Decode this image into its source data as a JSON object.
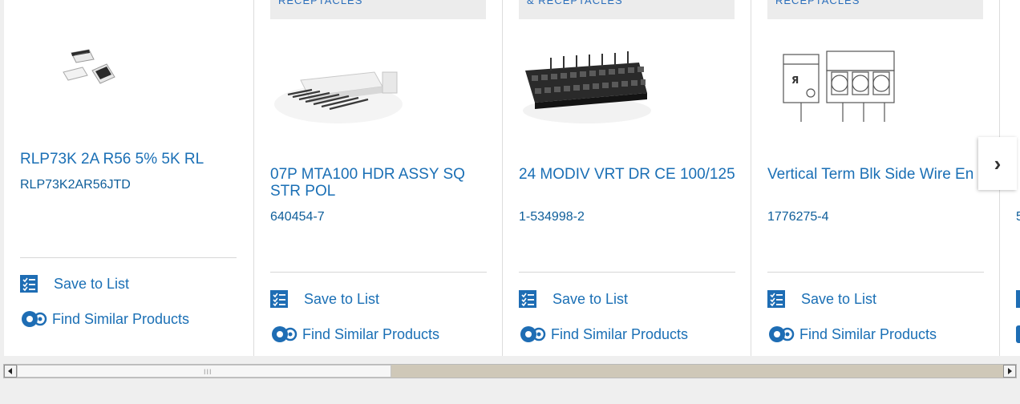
{
  "products": [
    {
      "category": "",
      "title": "RLP73K 2A R56 5% 5K RL",
      "part_number": "RLP73K2AR56JTD",
      "image": "smd-resistor-chips"
    },
    {
      "category": "RECEPTACLES",
      "title": "07P MTA100 HDR ASSY SQ STR POL",
      "part_number": "640454-7",
      "image": "mta-header-connector"
    },
    {
      "category": "& RECEPTACLES",
      "title": "24 MODIV VRT DR CE 100/125",
      "part_number": "1-534998-2",
      "image": "dual-row-receptacle"
    },
    {
      "category": "RECEPTACLES",
      "title": "Vertical Term Blk Side Wire En",
      "part_number": "1776275-4",
      "image": "terminal-block-drawing"
    },
    {
      "category": "",
      "title": "",
      "part_number": "5",
      "image": ""
    }
  ],
  "actions": {
    "save_label": "Save to List",
    "similar_label": "Find Similar Products"
  },
  "carousel": {
    "next_icon": "chevron-right-icon",
    "next_glyph": "›"
  },
  "scrollbar": {
    "left_icon": "arrow-left-icon",
    "right_icon": "arrow-right-icon",
    "position_fraction": 0.0,
    "visible_fraction": 0.37
  },
  "colors": {
    "link": "#1a6fb5",
    "part_number": "#0e5e9a",
    "icon_blue": "#1e6db4"
  }
}
